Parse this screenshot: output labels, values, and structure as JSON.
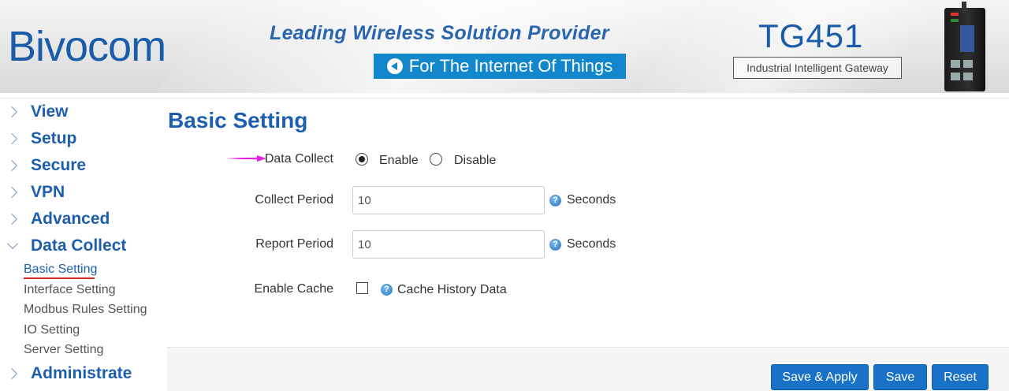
{
  "header": {
    "logo": "Bivocom",
    "tagline": "Leading Wireless Solution Provider",
    "iot_text": "For The Internet Of Things",
    "model": "TG451",
    "model_sub": "Industrial Intelligent Gateway"
  },
  "sidebar": {
    "items": [
      {
        "label": "View",
        "expanded": false
      },
      {
        "label": "Setup",
        "expanded": false
      },
      {
        "label": "Secure",
        "expanded": false
      },
      {
        "label": "VPN",
        "expanded": false
      },
      {
        "label": "Advanced",
        "expanded": false
      },
      {
        "label": "Data Collect",
        "expanded": true
      },
      {
        "label": "Administrate",
        "expanded": false
      }
    ],
    "sub_items": [
      {
        "label": "Basic Setting",
        "active": true
      },
      {
        "label": "Interface Setting",
        "active": false
      },
      {
        "label": "Modbus Rules Setting",
        "active": false
      },
      {
        "label": "IO Setting",
        "active": false
      },
      {
        "label": "Server Setting",
        "active": false
      }
    ]
  },
  "main": {
    "title": "Basic Setting",
    "data_collect": {
      "label": "Data Collect",
      "enable_label": "Enable",
      "disable_label": "Disable",
      "selected": "Enable"
    },
    "collect_period": {
      "label": "Collect Period",
      "value": "10",
      "unit": "Seconds"
    },
    "report_period": {
      "label": "Report Period",
      "value": "10",
      "unit": "Seconds"
    },
    "enable_cache": {
      "label": "Enable Cache",
      "checked": false,
      "hint": "Cache History Data"
    },
    "help_glyph": "?"
  },
  "buttons": {
    "save_apply": "Save & Apply",
    "save": "Save",
    "reset": "Reset"
  },
  "colors": {
    "brand_blue": "#1d5fae",
    "button_blue": "#1a72c6",
    "iot_box": "#1387cc",
    "arrow_magenta": "#e61ee6",
    "active_underline": "#d42525"
  }
}
